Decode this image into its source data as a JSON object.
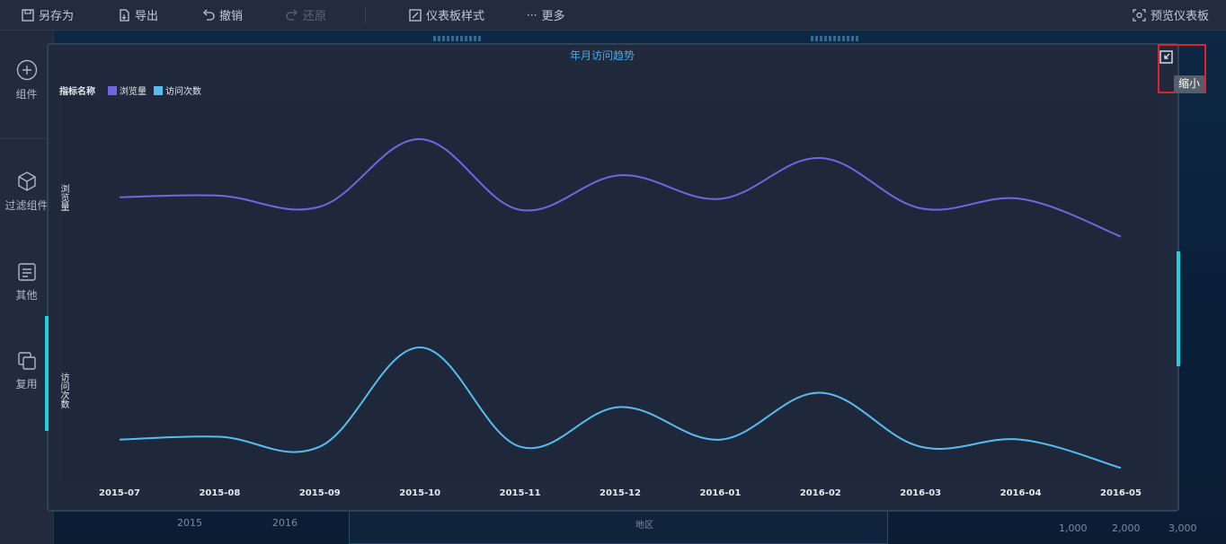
{
  "toolbar": {
    "save_as": "另存为",
    "export": "导出",
    "undo": "撤销",
    "redo": "还原",
    "dashboard_style": "仪表板样式",
    "more": "更多",
    "preview": "预览仪表板"
  },
  "sidebar": {
    "items": [
      {
        "label": "组件",
        "icon": "plus-circle-icon"
      },
      {
        "label": "过滤组件",
        "icon": "cube-icon"
      },
      {
        "label": "其他",
        "icon": "document-icon"
      },
      {
        "label": "复用",
        "icon": "copy-icon"
      }
    ]
  },
  "background": {
    "year_1": "2015",
    "year_2": "2016",
    "region": "地区",
    "tick_1000": "1,000",
    "tick_2000": "2,000",
    "tick_3000": "3,000"
  },
  "modal": {
    "shrink_tooltip": "缩小"
  },
  "colors": {
    "series_pv": "#7066e0",
    "series_visits": "#56bdf0",
    "accent": "#18d3e0"
  },
  "chart_data": {
    "type": "line",
    "title": "年月访问趋势",
    "legend_title": "指标名称",
    "legend_position": "top-left",
    "categories": [
      "2015-07",
      "2015-08",
      "2015-09",
      "2015-10",
      "2015-11",
      "2015-12",
      "2016-01",
      "2016-02",
      "2016-03",
      "2016-04",
      "2016-05"
    ],
    "series": [
      {
        "name": "浏览量",
        "axis_label": "浏览量",
        "values": [
          63,
          64,
          57,
          100,
          55,
          77,
          62,
          88,
          56,
          62,
          38
        ]
      },
      {
        "name": "访问次数",
        "axis_label": "访问次数",
        "values": [
          35,
          37,
          30,
          100,
          30,
          58,
          35,
          68,
          30,
          35,
          15
        ]
      }
    ],
    "grid": false
  }
}
